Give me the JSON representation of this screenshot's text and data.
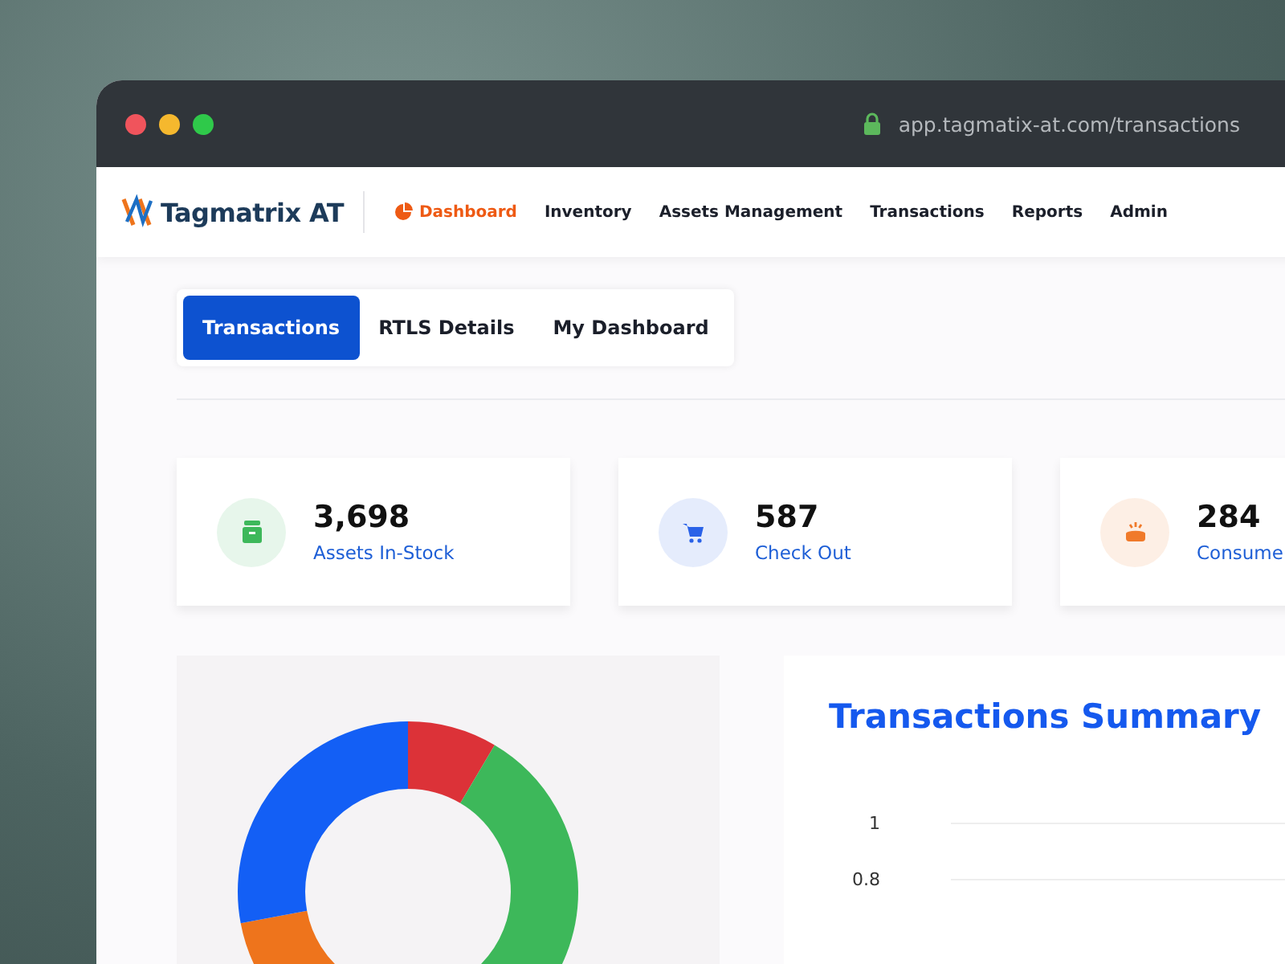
{
  "browser": {
    "url": "app.tagmatix-at.com/transactions"
  },
  "nav": {
    "brand": "Tagmatrix AT",
    "items": [
      {
        "label": "Dashboard",
        "selected": true
      },
      {
        "label": "Inventory",
        "selected": false
      },
      {
        "label": "Assets Management",
        "selected": false
      },
      {
        "label": "Transactions",
        "selected": false
      },
      {
        "label": "Reports",
        "selected": false
      },
      {
        "label": "Admin",
        "selected": false
      }
    ]
  },
  "tabs": [
    {
      "label": "Transactions",
      "selected": true
    },
    {
      "label": "RTLS Details",
      "selected": false
    },
    {
      "label": "My Dashboard",
      "selected": false
    }
  ],
  "stats": [
    {
      "value": "3,698",
      "label": "Assets In-Stock",
      "kind": "box",
      "color": "#3db85a"
    },
    {
      "value": "587",
      "label": "Check Out",
      "kind": "cart",
      "color": "#2a62e8"
    },
    {
      "value": "284",
      "label": "Consume",
      "kind": "bowl",
      "color": "#f07a2a"
    }
  ],
  "summary": {
    "title": "Transactions Summary",
    "y_axis_labels": [
      "1",
      "0.8"
    ]
  }
}
